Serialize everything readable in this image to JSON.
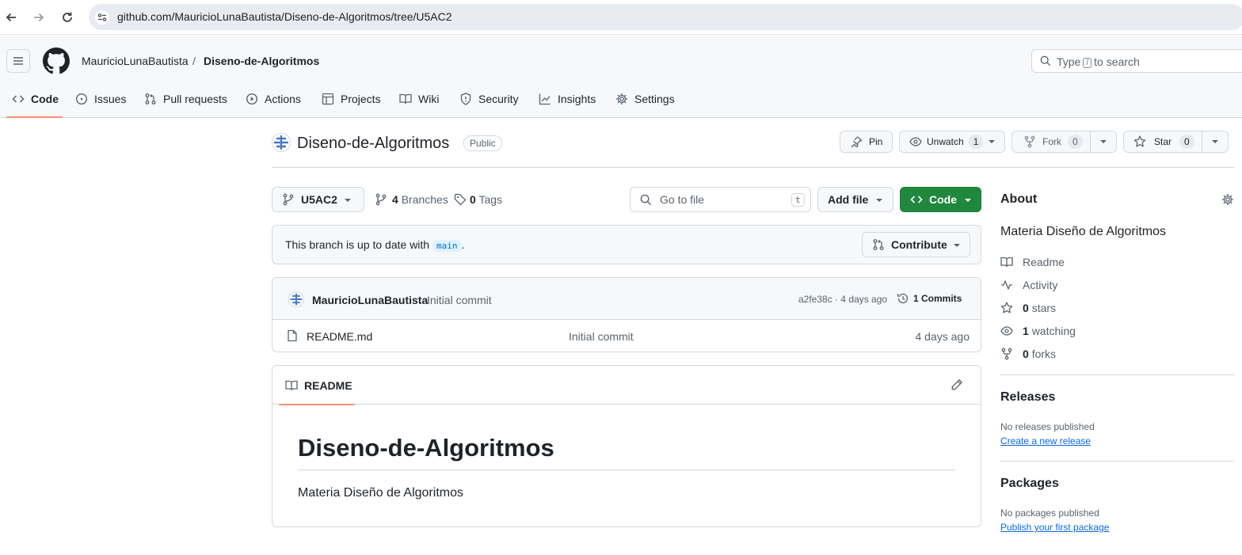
{
  "browser": {
    "url": "github.com/MauricioLunaBautista/Diseno-de-Algoritmos/tree/U5AC2"
  },
  "header": {
    "owner": "MauricioLunaBautista",
    "separator": "/",
    "repo": "Diseno-de-Algoritmos",
    "search_prefix": "Type",
    "search_key": "/",
    "search_suffix": "to search"
  },
  "tabs": [
    {
      "label": "Code",
      "icon": "code-icon",
      "active": true
    },
    {
      "label": "Issues",
      "icon": "issue-icon"
    },
    {
      "label": "Pull requests",
      "icon": "pull-request-icon"
    },
    {
      "label": "Actions",
      "icon": "play-icon"
    },
    {
      "label": "Projects",
      "icon": "table-icon"
    },
    {
      "label": "Wiki",
      "icon": "book-icon"
    },
    {
      "label": "Security",
      "icon": "shield-icon"
    },
    {
      "label": "Insights",
      "icon": "graph-icon"
    },
    {
      "label": "Settings",
      "icon": "gear-icon"
    }
  ],
  "repo": {
    "title": "Diseno-de-Algoritmos",
    "visibility": "Public",
    "pin_label": "Pin",
    "watch_label": "Unwatch",
    "watch_count": "1",
    "fork_label": "Fork",
    "fork_count": "0",
    "star_label": "Star",
    "star_count": "0"
  },
  "toolbar": {
    "branch": "U5AC2",
    "branches_count": "4",
    "branches_label": "Branches",
    "tags_count": "0",
    "tags_label": "Tags",
    "goto_placeholder": "Go to file",
    "goto_key": "t",
    "add_file": "Add file",
    "code": "Code"
  },
  "branch_status": {
    "text_before": "This branch is up to date with",
    "branch": "main",
    "text_after": ".",
    "contribute": "Contribute"
  },
  "latest_commit": {
    "author": "MauricioLunaBautista",
    "message": "Initial commit",
    "meta": "a2fe38c · 4 days ago",
    "commits_label": "1 Commits"
  },
  "files": [
    {
      "name": "README.md",
      "message": "Initial commit",
      "age": "4 days ago"
    }
  ],
  "readme": {
    "tab": "README",
    "heading": "Diseno-de-Algoritmos",
    "body": "Materia Diseño de Algoritmos"
  },
  "about": {
    "title": "About",
    "description": "Materia Diseño de Algoritmos",
    "readme": "Readme",
    "activity": "Activity",
    "stars_count": "0",
    "stars_label": "stars",
    "watching_count": "1",
    "watching_label": "watching",
    "forks_count": "0",
    "forks_label": "forks"
  },
  "releases": {
    "title": "Releases",
    "empty": "No releases published",
    "link": "Create a new release"
  },
  "packages": {
    "title": "Packages",
    "empty": "No packages published",
    "link": "Publish your first package"
  },
  "colors": {
    "accent_tab": "#fd8c73",
    "green_button": "#1f883d",
    "link": "#0969da"
  }
}
